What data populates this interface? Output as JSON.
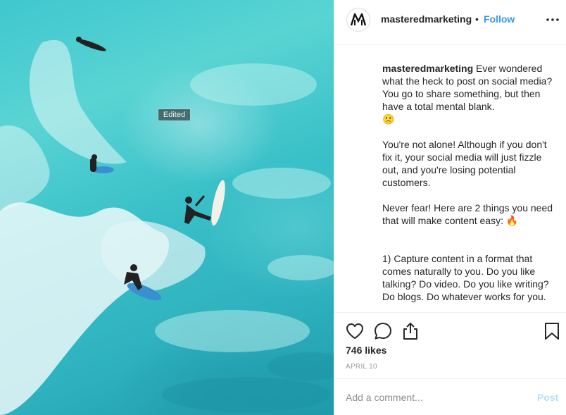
{
  "photo": {
    "badge": "Edited"
  },
  "header": {
    "username": "masteredmarketing",
    "separator": "•",
    "follow_label": "Follow",
    "more_icon": "more-horizontal-icon",
    "avatar_icon": "mastered-marketing-logo"
  },
  "caption": {
    "username": "masteredmarketing",
    "intro": " Ever wondered what the heck to post on social media? You go to share something, but then have a total mental blank.",
    "emoji_1": "🙁",
    "para_2": "You're not alone! Although if you don't fix it, your social media will just fizzle out, and you're losing potential customers.",
    "para_3": "Never fear! Here are 2 things you need that will make content easy:",
    "emoji_2": "🔥",
    "para_4": "1) Capture content in a format that comes naturally to you. Do you like talking? Do video. Do you like writing? Do blogs. Do whatever works for you."
  },
  "actions": {
    "like_icon": "heart-icon",
    "comment_icon": "comment-icon",
    "share_icon": "share-icon",
    "save_icon": "bookmark-icon",
    "likes": "746 likes",
    "date": "APRIL 10"
  },
  "comment": {
    "placeholder": "Add a comment...",
    "post_label": "Post"
  },
  "colors": {
    "accent": "#3897f0",
    "post_disabled": "#b2dffc",
    "text": "#262626",
    "muted": "#999999",
    "border": "#efefef"
  }
}
